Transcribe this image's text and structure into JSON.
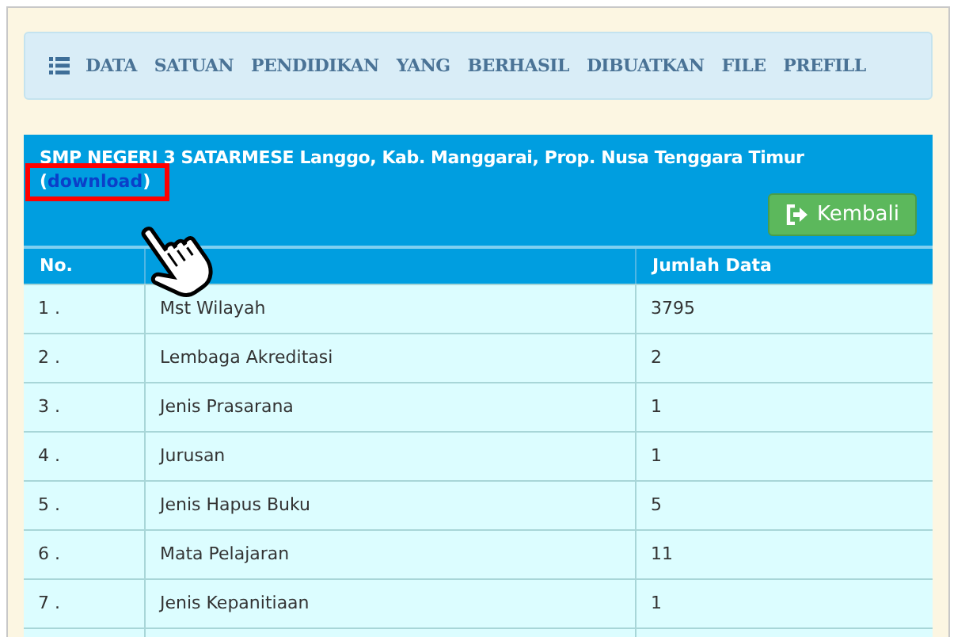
{
  "heading": {
    "words": [
      "DATA",
      "SATUAN",
      "PENDIDIKAN",
      "YANG",
      "BERHASIL",
      "DIBUATKAN",
      "FILE",
      "PREFILL"
    ]
  },
  "panel": {
    "title": "SMP NEGERI 3 SATARMESE Langgo, Kab. Manggarai, Prop. Nusa Tenggara Timur",
    "link_open": "(",
    "link": "download",
    "link_close": ")",
    "button": "Kembali"
  },
  "table": {
    "columns": [
      "No.",
      "Jumlah Data"
    ],
    "rows": [
      {
        "no": "1 .",
        "name": "Mst Wilayah",
        "count": "3795"
      },
      {
        "no": "2 .",
        "name": "Lembaga Akreditasi",
        "count": "2"
      },
      {
        "no": "3 .",
        "name": "Jenis Prasarana",
        "count": "1"
      },
      {
        "no": "4 .",
        "name": "Jurusan",
        "count": "1"
      },
      {
        "no": "5 .",
        "name": "Jenis Hapus Buku",
        "count": "5"
      },
      {
        "no": "6 .",
        "name": "Mata Pelajaran",
        "count": "11"
      },
      {
        "no": "7 .",
        "name": "Jenis Kepanitiaan",
        "count": "1"
      }
    ]
  }
}
